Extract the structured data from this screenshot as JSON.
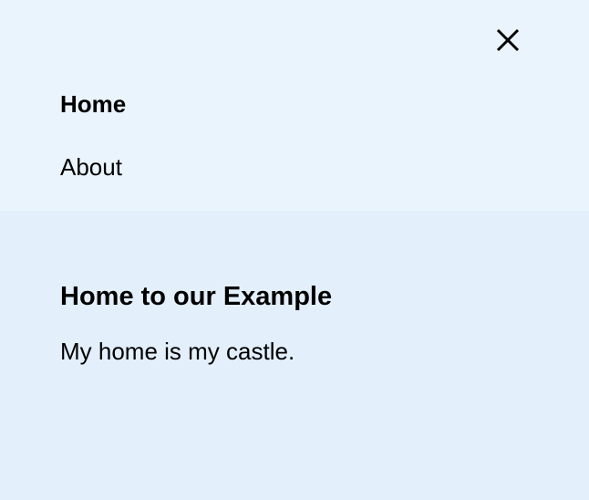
{
  "nav": {
    "close_icon": "close-icon",
    "items": [
      {
        "label": "Home",
        "active": true
      },
      {
        "label": "About",
        "active": false
      }
    ]
  },
  "main": {
    "title": "Home to our Example",
    "text": "My home is my castle."
  },
  "colors": {
    "nav_background": "#eaf4fd",
    "content_background": "#e3effa",
    "text": "#000000"
  }
}
